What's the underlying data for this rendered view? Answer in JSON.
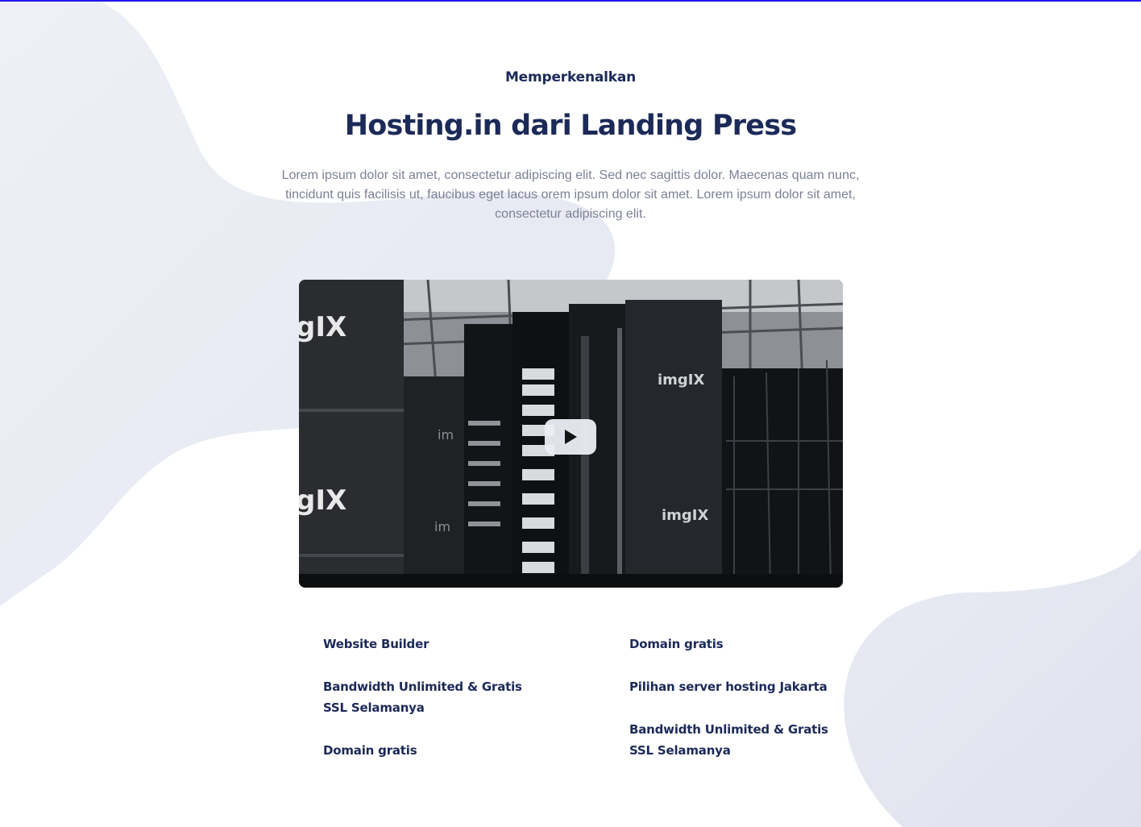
{
  "header": {
    "eyebrow": "Memperkenalkan",
    "title": "Hosting.in dari Landing Press",
    "description": "Lorem ipsum dolor sit amet, consectetur adipiscing elit. Sed nec sagittis dolor. Maecenas quam nunc, tincidunt quis facilisis ut, faucibus eget lacus orem ipsum dolor sit amet. Lorem ipsum dolor sit amet, consectetur adipiscing elit."
  },
  "video": {
    "thumbnail_brand_text": "imgIX",
    "play_icon": "play-icon"
  },
  "features": {
    "left": [
      "Website Builder",
      "Bandwidth Unlimited & Gratis SSL Selamanya",
      "Domain gratis"
    ],
    "right": [
      "Domain gratis",
      "Pilihan server hosting Jakarta",
      "Bandwidth Unlimited & Gratis SSL Selamanya"
    ]
  },
  "colors": {
    "heading": "#1c2a58",
    "body_text": "#7b8196",
    "blob": "#eceef5",
    "accent_line": "#1f17f0"
  }
}
